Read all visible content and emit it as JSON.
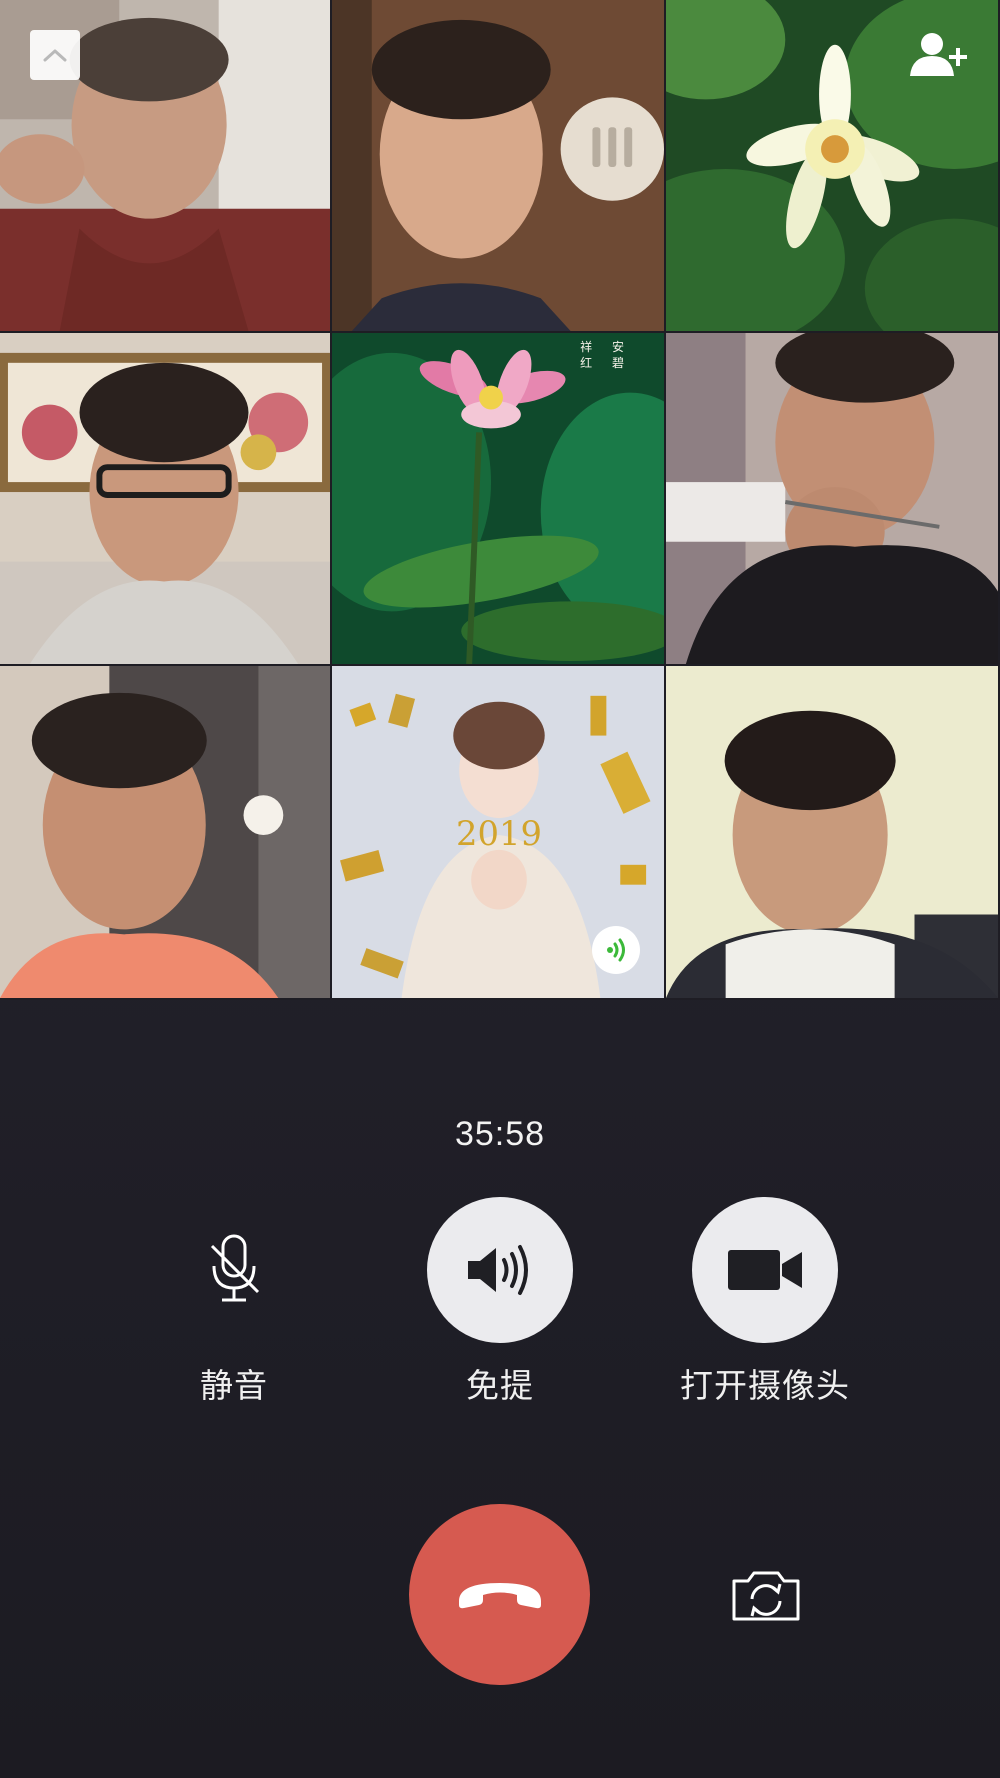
{
  "call": {
    "timer": "35:58"
  },
  "participants": [
    {
      "id": "p1",
      "video": "on"
    },
    {
      "id": "p2",
      "video": "on"
    },
    {
      "id": "p3",
      "video": "avatar",
      "avatar": "white-water-lily"
    },
    {
      "id": "p4",
      "video": "on"
    },
    {
      "id": "p5",
      "video": "avatar",
      "avatar": "pink-lotus",
      "caption_lines": [
        "祥 安",
        "红 碧"
      ]
    },
    {
      "id": "p6",
      "video": "on"
    },
    {
      "id": "p7",
      "video": "on"
    },
    {
      "id": "p8",
      "video": "avatar",
      "avatar": "portrait-2019",
      "speaking": true
    },
    {
      "id": "p9",
      "video": "on"
    }
  ],
  "controls": {
    "mute_label": "静音",
    "speaker_label": "免提",
    "camera_label": "打开摄像头"
  },
  "icons": {
    "collapse": "chevron-up-icon",
    "add_member": "add-user-icon",
    "mute": "microphone-off-icon",
    "speaker": "speaker-icon",
    "camera": "video-camera-icon",
    "hangup": "phone-hangup-icon",
    "flip_camera": "flip-camera-icon",
    "speaking": "sound-wave-icon"
  },
  "colors": {
    "background": "#1e1d24",
    "hangup": "#d65a50",
    "control_fill": "#ebebee",
    "speaking_indicator": "#3cb93a"
  }
}
